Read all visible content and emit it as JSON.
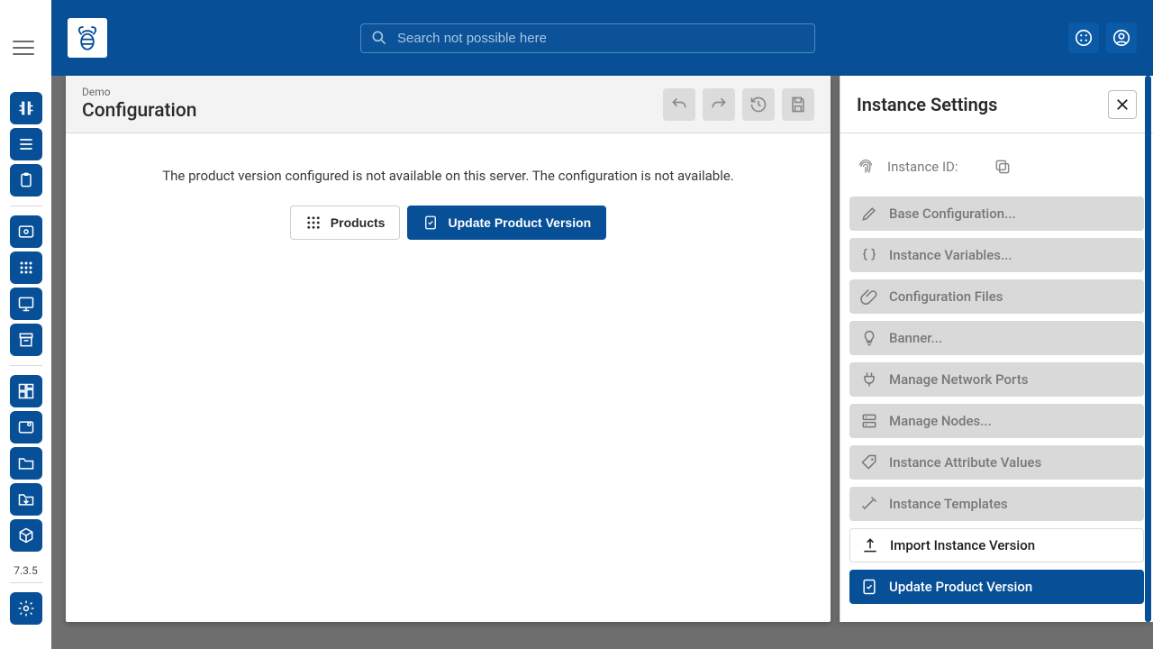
{
  "colors": {
    "accent": "#074f97"
  },
  "rail": {
    "version": "7.3.5",
    "items": [
      {
        "icon": "config-icon",
        "name": "nav-config"
      },
      {
        "icon": "list-icon",
        "name": "nav-list"
      },
      {
        "icon": "clipboard-icon",
        "name": "nav-clipboard"
      },
      {
        "icon": "cloud-icon",
        "name": "nav-cloud"
      },
      {
        "icon": "grid-icon",
        "name": "nav-grid"
      },
      {
        "icon": "monitor-icon",
        "name": "nav-monitor"
      },
      {
        "icon": "archive-icon",
        "name": "nav-archive"
      },
      {
        "icon": "dashboard-icon",
        "name": "nav-dashboard"
      },
      {
        "icon": "settings2-icon",
        "name": "nav-settings2"
      },
      {
        "icon": "folder-icon",
        "name": "nav-folder"
      },
      {
        "icon": "import-icon",
        "name": "nav-import"
      },
      {
        "icon": "package-icon",
        "name": "nav-package"
      },
      {
        "icon": "gear-icon",
        "name": "nav-gear"
      }
    ]
  },
  "topbar": {
    "search_placeholder": "Search not possible here"
  },
  "main": {
    "crumb": "Demo",
    "title": "Configuration",
    "message": "The product version configured is not available on this server. The configuration is not available.",
    "buttons": {
      "products": "Products",
      "update": "Update Product Version"
    }
  },
  "side": {
    "title": "Instance Settings",
    "instance_id_label": "Instance ID:",
    "actions": [
      {
        "label": "Base Configuration...",
        "state": "disabled",
        "icon": "pencil-icon",
        "name": "action-base-config"
      },
      {
        "label": "Instance Variables...",
        "state": "disabled",
        "icon": "braces-icon",
        "name": "action-instance-vars"
      },
      {
        "label": "Configuration Files",
        "state": "disabled",
        "icon": "attach-icon",
        "name": "action-config-files"
      },
      {
        "label": "Banner...",
        "state": "disabled",
        "icon": "bulb-icon",
        "name": "action-banner"
      },
      {
        "label": "Manage Network Ports",
        "state": "disabled",
        "icon": "plug-icon",
        "name": "action-ports"
      },
      {
        "label": "Manage Nodes...",
        "state": "disabled",
        "icon": "server-icon",
        "name": "action-nodes"
      },
      {
        "label": "Instance Attribute Values",
        "state": "disabled",
        "icon": "tag-icon",
        "name": "action-attrs"
      },
      {
        "label": "Instance Templates",
        "state": "disabled",
        "icon": "wand-icon",
        "name": "action-templates"
      },
      {
        "label": "Import Instance Version",
        "state": "enabled",
        "icon": "upload-icon",
        "name": "action-import"
      },
      {
        "label": "Update Product Version",
        "state": "primary",
        "icon": "update-icon",
        "name": "action-update"
      }
    ]
  }
}
